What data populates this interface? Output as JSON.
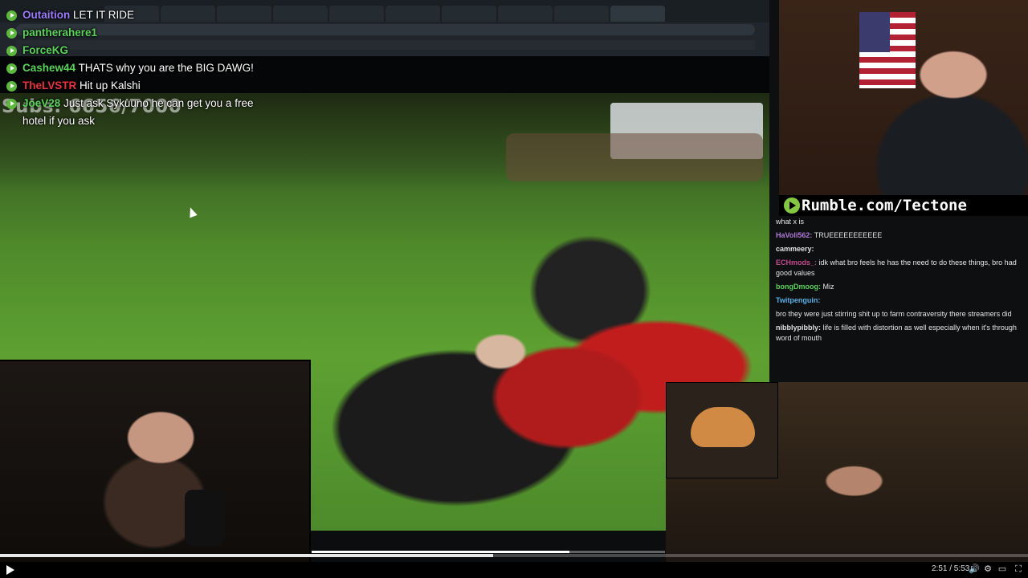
{
  "overlay": {
    "subs_text": "Subs: 6656/7000"
  },
  "chat": [
    {
      "user": "Outaition",
      "user_color": "#9b7cff",
      "text": "LET IT RIDE"
    },
    {
      "user": "pantherahere1",
      "user_color": "#5bd35b",
      "text": ""
    },
    {
      "user": "ForceKG",
      "user_color": "#5bd35b",
      "text": ""
    },
    {
      "user": "Cashew44",
      "user_color": "#5bd35b",
      "text": "THATS why you are the BIG DAWG!"
    },
    {
      "user": "TheLVSTR",
      "user_color": "#e8333c",
      "text": "Hit up Kalshi"
    },
    {
      "user": "JoeV28",
      "user_color": "#5bd35b",
      "text": "Just ask Sykuuno he can get you a free hotel if you ask"
    }
  ],
  "rumble": {
    "label": "Rumble.com/Tectone"
  },
  "side_chat": [
    {
      "user": "",
      "text": "what x is"
    },
    {
      "user": "HaVoli562:",
      "user_color": "#b07ad8",
      "text": "TRUEEEEEEEEEEE"
    },
    {
      "user": "cammeery:",
      "user_color": "#e0e0e0",
      "text": ""
    },
    {
      "user": "ECHmods_:",
      "user_color": "#c3498f",
      "text": "idk what bro feels he has the need to do these things, bro had good values"
    },
    {
      "user": "bongDmoog:",
      "user_color": "#5bd35b",
      "text": "Miz"
    },
    {
      "user": "Twitpenguin:",
      "user_color": "#5bb2e8",
      "text": ""
    },
    {
      "user": "",
      "user_color": "#e8333c",
      "text": "bro they were just stirring shit up to farm contraversity there streamers did"
    },
    {
      "user": "nibblypibbly:",
      "user_color": "#e0e0e0",
      "text": "life is filled with distortion as well especially when it's through word of mouth"
    }
  ],
  "player": {
    "time": "2:51 / 5:53",
    "progress": 0.48,
    "inner_progress": 0.73
  }
}
